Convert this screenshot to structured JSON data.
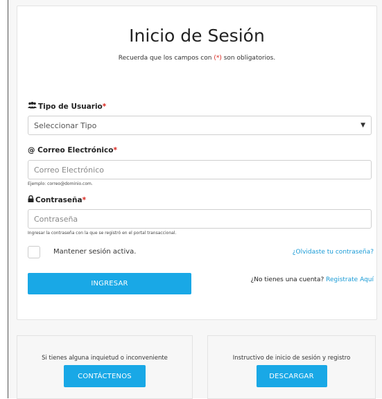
{
  "login": {
    "title": "Inicio de Sesión",
    "subtitle_before": "Recuerda que los campos con ",
    "subtitle_marker": "(*)",
    "subtitle_after": " son obligatorios.",
    "user_type": {
      "label": "Tipo de Usuario",
      "required_mark": "*",
      "selected": "Seleccionar Tipo"
    },
    "email": {
      "label": "@ Correo Electrónico",
      "required_mark": "*",
      "placeholder": "Correo Electrónico",
      "hint": "Ejemplo: correo@dominio.com."
    },
    "password": {
      "label": "Contraseña",
      "required_mark": "*",
      "placeholder": "Contraseña",
      "hint": "Ingresar la contraseña con la que se registró en el portal transaccional."
    },
    "remember_label": "Mantener sesión activa.",
    "forgot_link": "¿Olvidaste tu contraseña?",
    "login_button": "INGRESAR",
    "no_account_text": "¿No tienes una cuenta?",
    "register_link": "Registrate Aquí"
  },
  "contact_box": {
    "text": "Si tienes alguna inquietud o inconveniente",
    "button": "CONTÁCTENOS"
  },
  "instructions_box": {
    "text": "Instructivo de inicio de sesión y registro",
    "button": "DESCARGAR"
  },
  "colors": {
    "accent": "#19a8e6",
    "link": "#1a9bd6",
    "required": "#d9251d"
  }
}
